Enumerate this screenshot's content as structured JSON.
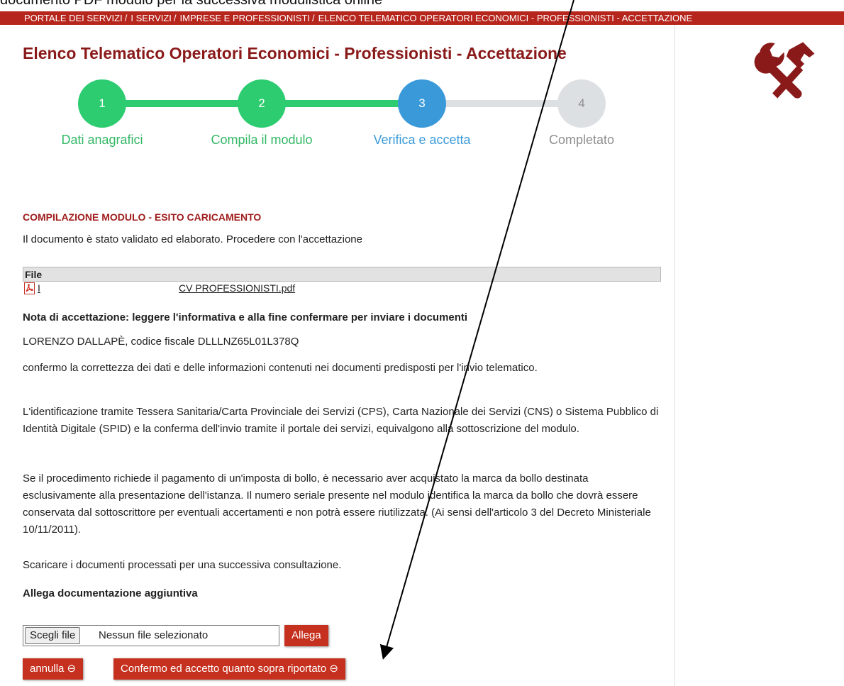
{
  "top_cut_text": "documento PDF modulo per la successiva modulistica online",
  "breadcrumb": [
    {
      "label": "PORTALE DEI SERVIZI"
    },
    {
      "label": "I SERVIZI"
    },
    {
      "label": "IMPRESE E PROFESSIONISTI"
    },
    {
      "label": "ELENCO TELEMATICO OPERATORI ECONOMICI - PROFESSIONISTI - ACCETTAZIONE"
    }
  ],
  "breadcrumb_separator": "/",
  "page_title": "Elenco Telematico Operatori Economici - Professionisti - Accettazione",
  "steps": [
    {
      "number": "1",
      "label": "Dati anagrafici",
      "state": "done"
    },
    {
      "number": "2",
      "label": "Compila il modulo",
      "state": "done"
    },
    {
      "number": "3",
      "label": "Verifica e accetta",
      "state": "current"
    },
    {
      "number": "4",
      "label": "Completato",
      "state": "todo"
    }
  ],
  "colors": {
    "brand_red": "#b7261d",
    "title_red": "#8a1a1a",
    "step_done": "#2ecc71",
    "step_current": "#3a9ad9",
    "step_todo": "#dde0e3",
    "label_done": "#33b865",
    "label_current": "#3a9ad9",
    "label_todo": "#8f8f8f"
  },
  "section_title": "COMPILAZIONE MODULO - ESITO CARICAMENTO",
  "status_text": "Il documento è stato validato ed elaborato. Procedere con l'accettazione",
  "file_table": {
    "header": "File",
    "rows": [
      {
        "icon": "pdf-icon",
        "col1": "I",
        "col2": "CV PROFESSIONISTI.pdf"
      }
    ]
  },
  "note_title": "Nota di accettazione: leggere l'informativa e alla fine confermare per inviare i documenti",
  "signer_line": "LORENZO DALLAPÈ, codice fiscale DLLLNZ65L01L378Q",
  "paragraphs": [
    "confermo la correttezza dei dati e delle informazioni contenuti nei documenti predisposti per l'invio telematico.",
    "L'identificazione tramite Tessera Sanitaria/Carta Provinciale dei Servizi (CPS), Carta Nazionale dei Servizi (CNS) o Sistema Pubblico di Identità Digitale (SPID) e la conferma dell'invio tramite il portale dei servizi, equivalgono alla sottoscrizione del modulo.",
    "Se il procedimento richiede il pagamento di un'imposta di bollo, è necessario aver acquistato la marca da bollo destinata esclusivamente alla presentazione dell'istanza. Il numero seriale presente nel modulo identifica la marca da bollo che dovrà essere conservata dal sottoscrittore per eventuali accertamenti e non potrà essere riutilizzata. (Ai sensi dell'articolo 3 del Decreto Ministeriale 10/11/2011).",
    "Scaricare i documenti processati per una successiva consultazione."
  ],
  "attach_title": "Allega documentazione aggiuntiva",
  "file_input": {
    "button_label": "Scegli file",
    "status": "Nessun file selezionato"
  },
  "buttons": {
    "attach": "Allega",
    "cancel": "annulla ⊖",
    "confirm": "Confermo ed accetto quanto sopra riportato ⊖"
  },
  "sidebar_icon": "tools-icon"
}
